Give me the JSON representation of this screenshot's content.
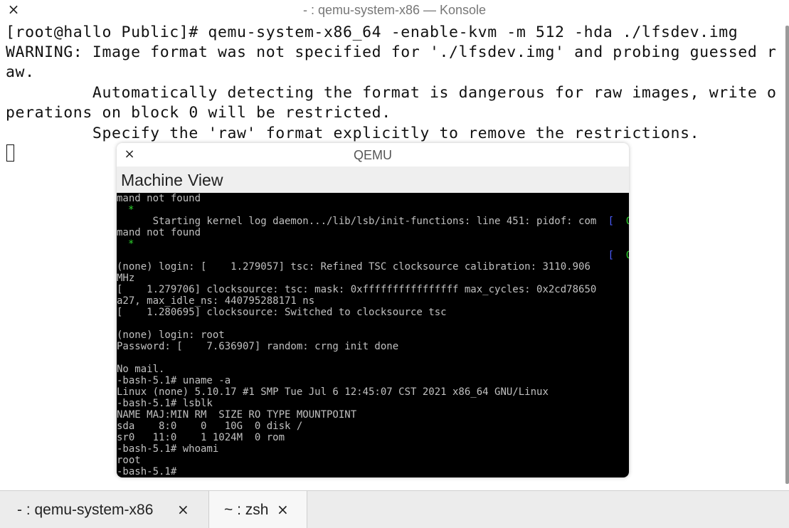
{
  "konsole": {
    "title": "- : qemu-system-x86 — Konsole",
    "close_icon": "×",
    "terminal_lines": [
      "[root@hallo Public]# qemu-system-x86_64 -enable-kvm -m 512 -hda ./lfsdev.img",
      "WARNING: Image format was not specified for './lfsdev.img' and probing guessed r",
      "aw.",
      "         Automatically detecting the format is dangerous for raw images, write o",
      "perations on block 0 will be restricted.",
      "         Specify the 'raw' format explicitly to remove the restrictions."
    ]
  },
  "qemu": {
    "title": "QEMU",
    "close_icon": "×",
    "menu": [
      "Machine",
      "View"
    ],
    "ok_tag": "[  OK  ]",
    "ok_star": "*",
    "screen_lines": [
      "mand not found",
      "",
      "      Starting kernel log daemon.../lib/lsb/init-functions: line 451: pidof: com",
      "mand not found",
      "",
      "",
      "(none) login: [    1.279057] tsc: Refined TSC clocksource calibration: 3110.906",
      "MHz",
      "[    1.279706] clocksource: tsc: mask: 0xffffffffffffffff max_cycles: 0x2cd78650",
      "a27, max_idle_ns: 440795288171 ns",
      "[    1.280695] clocksource: Switched to clocksource tsc",
      "",
      "(none) login: root",
      "Password: [    7.636907] random: crng init done",
      "",
      "No mail.",
      "-bash-5.1# uname -a",
      "Linux (none) 5.10.17 #1 SMP Tue Jul 6 12:45:07 CST 2021 x86_64 GNU/Linux",
      "-bash-5.1# lsblk",
      "NAME MAJ:MIN RM  SIZE RO TYPE MOUNTPOINT",
      "sda    8:0    0   10G  0 disk /",
      "sr0   11:0    1 1024M  0 rom",
      "-bash-5.1# whoami",
      "root",
      "-bash-5.1#"
    ]
  },
  "tabs": [
    {
      "label": "- : qemu-system-x86",
      "close": "×"
    },
    {
      "label": "~ : zsh",
      "close": "×"
    }
  ],
  "colors": {
    "vga_text": "#c0c0c0",
    "vga_ok_green": "#2ed62e",
    "vga_bracket_blue": "#4a5cff"
  }
}
